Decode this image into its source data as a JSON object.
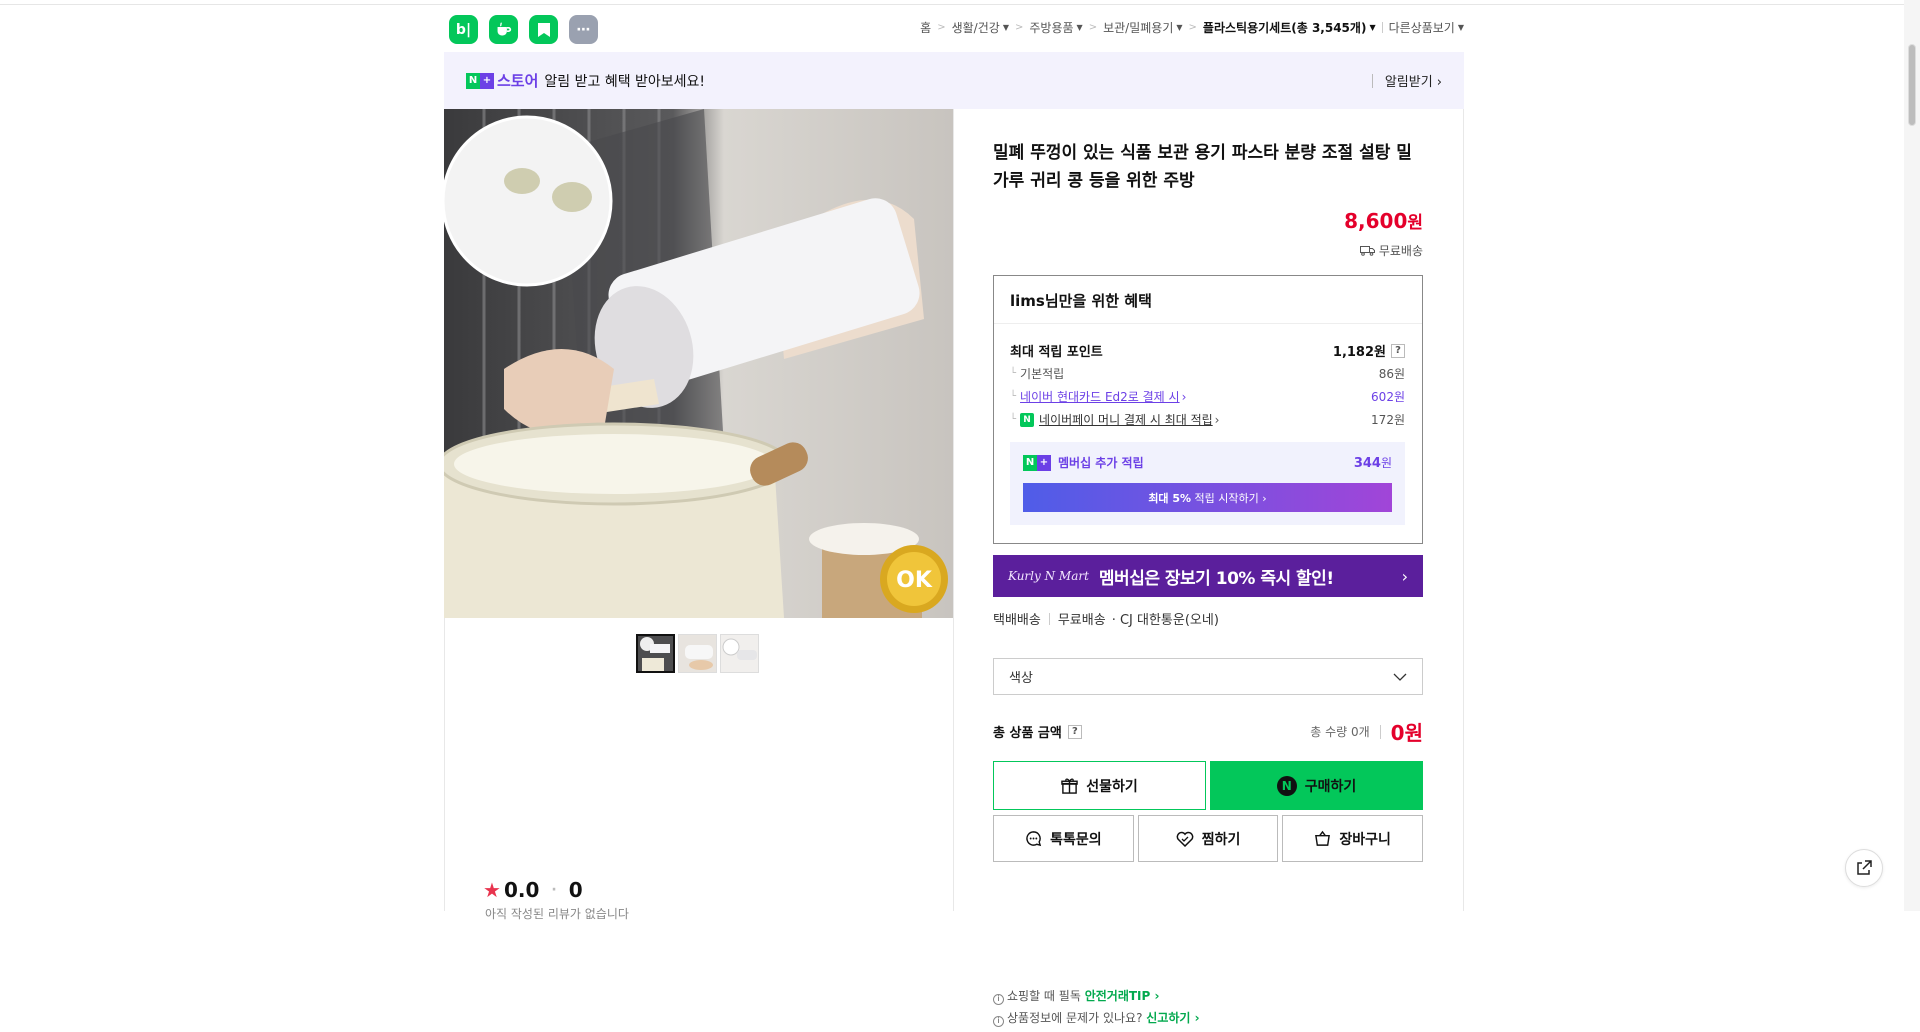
{
  "header": {
    "apps": [
      {
        "name": "blog-app-icon",
        "glyph": "b|",
        "color": "#03c75a"
      },
      {
        "name": "cafe-app-icon",
        "glyph": "☕",
        "color": "#03c75a"
      },
      {
        "name": "bookmark-app-icon",
        "glyph": "▮",
        "color": "#03c75a"
      },
      {
        "name": "more-app-icon",
        "glyph": "⋯",
        "color": "#9aa1b0"
      }
    ],
    "breadcrumb": [
      "홈",
      "생활/건강",
      "주방용품",
      "보관/밀폐용기",
      "플라스틱용기세트(총 3,545개)"
    ],
    "other_products": "다른상품보기"
  },
  "store_banner": {
    "brand_n": "N",
    "brand_plus": "+",
    "store_word": "스토어",
    "message": "알림 받고 혜택 받아보세요!",
    "alarm_button": "알림받기 ›"
  },
  "product": {
    "title": "밀폐 뚜껑이 있는 식품 보관 용기 파스타 분량 조절 설탕 밀가루 귀리 콩 등을 위한 주방",
    "price": "8,600",
    "price_unit": "원",
    "shipping_label": "무료배송",
    "image_badge": "OK"
  },
  "benefit": {
    "heading_user": "lims",
    "heading_rest": "님만을 위한 혜택",
    "max_points_label": "최대 적립 포인트",
    "max_points_value": "1,182원",
    "rows": [
      {
        "label": "기본적립",
        "value": "86원"
      },
      {
        "label": "네이버 현대카드 Ed2로 결제 시",
        "value": "602원"
      },
      {
        "label": "네이버페이 머니 결제 시 최대 적립",
        "value": "172원"
      }
    ],
    "membership_label": "멤버십 추가 적립",
    "membership_value": "344",
    "membership_unit": "원",
    "membership_button_bold": "최대 5%",
    "membership_button_rest": " 적립 시작하기 ›"
  },
  "kurly_banner": {
    "logo": "Kurly N Mart",
    "text": "멤버십은 장보기 10% 즉시 할인!"
  },
  "delivery": {
    "type": "택배배송",
    "fee": "무료배송",
    "carrier": "· CJ 대한통운(오네)"
  },
  "option_select": {
    "placeholder": "색상"
  },
  "total": {
    "label": "총 상품 금액",
    "qty": "총 수량 0개",
    "amount": "0원"
  },
  "buttons": {
    "gift": "선물하기",
    "buy": "구매하기",
    "talk": "톡톡문의",
    "wish": "찜하기",
    "cart": "장바구니"
  },
  "tips": {
    "line1_text": "쇼핑할 때 필독",
    "line1_link": "안전거래TIP ›",
    "line2_text": "상품정보에 문제가 있나요?",
    "line2_link": "신고하기 ›"
  },
  "rating": {
    "score": "0.0",
    "count": "0",
    "note": "아직 작성된 리뷰가 없습니다"
  }
}
